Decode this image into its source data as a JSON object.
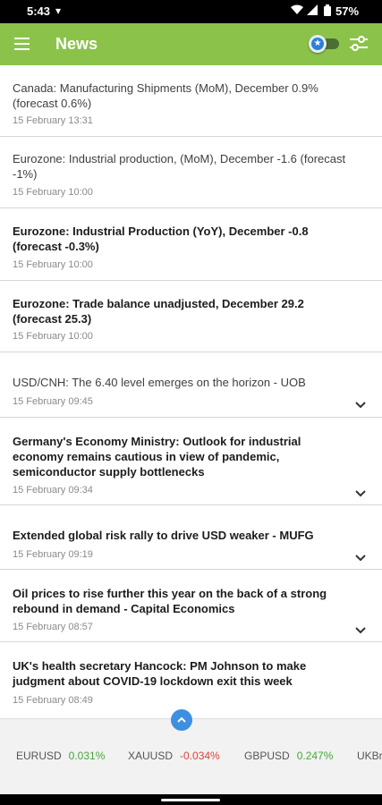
{
  "status_bar": {
    "time": "5:43",
    "battery": "57%",
    "icons": [
      "wifi-icon",
      "signal-icon",
      "battery-icon"
    ]
  },
  "app_bar": {
    "title": "News",
    "background_color": "#8bc34a",
    "menu_icon": "hamburger-menu-icon",
    "toggle_icon": "star-toggle-icon",
    "filter_icon": "filter-sliders-icon"
  },
  "news": [
    {
      "title": "Canada: Manufacturing Shipments (MoM), December 0.9% (forecast 0.6%)",
      "time": "15 February 13:31",
      "bold": false,
      "expandable": false
    },
    {
      "title": "Eurozone: Industrial production, (MoM), December -1.6 (forecast -1%)",
      "time": "15 February 10:00",
      "bold": false,
      "expandable": false
    },
    {
      "title": "Eurozone: Industrial Production (YoY), December -0.8 (forecast -0.3%)",
      "time": "15 February 10:00",
      "bold": true,
      "expandable": false
    },
    {
      "title": "Eurozone: Trade balance unadjusted, December 29.2 (forecast 25.3)",
      "time": "15 February 10:00",
      "bold": true,
      "expandable": false
    },
    {
      "title": "USD/CNH: The 6.40 level emerges on the horizon - UOB",
      "time": "15 February 09:45",
      "bold": false,
      "expandable": true
    },
    {
      "title": "Germany's Economy Ministry: Outlook for industrial economy remains cautious in view of pandemic, semiconductor supply bottlenecks",
      "time": "15 February 09:34",
      "bold": true,
      "expandable": true
    },
    {
      "title": "Extended global risk rally to drive USD weaker - MUFG",
      "time": "15 February 09:19",
      "bold": true,
      "expandable": true
    },
    {
      "title": "Oil prices to rise further this year on the back of a strong rebound in demand - Capital Economics",
      "time": "15 February 08:57",
      "bold": true,
      "expandable": true
    },
    {
      "title": "UK's health secretary Hancock: PM Johnson to make judgment about COVID-19 lockdown exit this week",
      "time": "15 February 08:49",
      "bold": true,
      "expandable": true
    }
  ],
  "tickers": [
    {
      "symbol": "EURUSD",
      "change": "0.031%",
      "direction": "up"
    },
    {
      "symbol": "XAUUSD",
      "change": "-0.034%",
      "direction": "down"
    },
    {
      "symbol": "GBPUSD",
      "change": "0.247%",
      "direction": "up"
    },
    {
      "symbol": "UKBr",
      "change": "",
      "direction": "up"
    }
  ],
  "colors": {
    "positive": "#4aa53d",
    "negative": "#e0413a",
    "accent_blue": "#3d8fe0"
  }
}
